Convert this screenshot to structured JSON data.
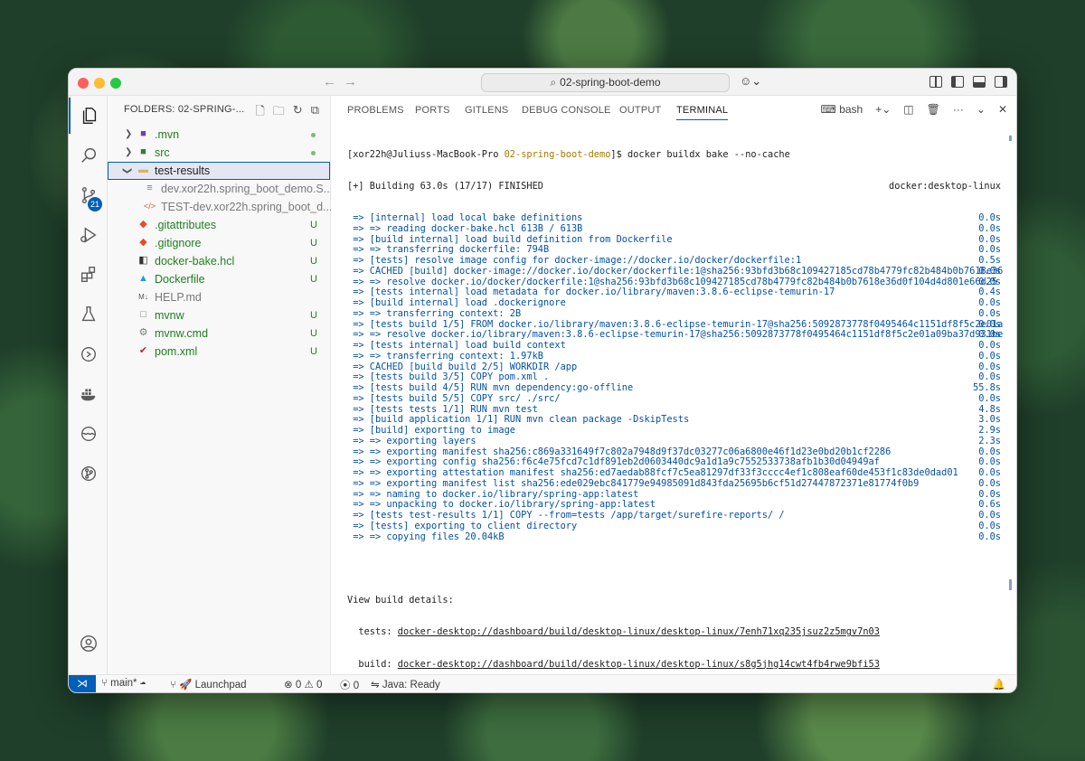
{
  "titlebar": {
    "search_text": "02-spring-boot-demo",
    "search_icon": "search-icon",
    "copilot_icon": "copilot-icon"
  },
  "activity_bar": {
    "items": [
      "explorer-icon",
      "search-icon",
      "source-control-icon",
      "run-debug-icon",
      "extensions-icon",
      "testing-icon",
      "remote-explorer-icon",
      "docker-icon",
      "wave-icon",
      "git-graph-icon",
      "account-icon",
      "settings-gear-icon"
    ],
    "source_control_badge": "21"
  },
  "sidebar": {
    "header": "FOLDERS: 02-SPRING-...",
    "items": [
      {
        "name": ".mvn",
        "status": "dot",
        "kind": "folder"
      },
      {
        "name": "src",
        "status": "dot",
        "kind": "folder"
      },
      {
        "name": "test-results",
        "status": "",
        "kind": "folder-open"
      },
      {
        "name": "dev.xor22h.spring_boot_demo.S...",
        "status": "",
        "kind": "file"
      },
      {
        "name": "TEST-dev.xor22h.spring_boot_d...",
        "status": "",
        "kind": "file"
      },
      {
        "name": ".gitattributes",
        "status": "U",
        "kind": "file"
      },
      {
        "name": ".gitignore",
        "status": "U",
        "kind": "file"
      },
      {
        "name": "docker-bake.hcl",
        "status": "U",
        "kind": "file"
      },
      {
        "name": "Dockerfile",
        "status": "U",
        "kind": "file"
      },
      {
        "name": "HELP.md",
        "status": "",
        "kind": "file"
      },
      {
        "name": "mvnw",
        "status": "U",
        "kind": "file"
      },
      {
        "name": "mvnw.cmd",
        "status": "U",
        "kind": "file"
      },
      {
        "name": "pom.xml",
        "status": "U",
        "kind": "file"
      }
    ]
  },
  "panel": {
    "tabs": [
      "PROBLEMS",
      "PORTS",
      "GITLENS",
      "DEBUG CONSOLE",
      "OUTPUT",
      "TERMINAL"
    ],
    "active_tab": "TERMINAL",
    "shell_label": "bash"
  },
  "terminal": {
    "prompt_user": "xor22h",
    "prompt_host": "Juliuss-MacBook-Pro",
    "prompt_dir": "02-spring-boot-demo",
    "command": "$ docker buildx bake --no-cache",
    "header": "[+] Building 63.0s (17/17) FINISHED",
    "header_right": "docker:desktop-linux",
    "lines": [
      {
        "text": " => [internal] load local bake definitions",
        "dur": "0.0s"
      },
      {
        "text": " => => reading docker-bake.hcl 613B / 613B",
        "dur": "0.0s"
      },
      {
        "text": " => [build internal] load build definition from Dockerfile",
        "dur": "0.0s"
      },
      {
        "text": " => => transferring dockerfile: 794B",
        "dur": "0.0s"
      },
      {
        "text": " => [tests] resolve image config for docker-image://docker.io/docker/dockerfile:1",
        "dur": "0.5s"
      },
      {
        "text": " => CACHED [build] docker-image://docker.io/docker/dockerfile:1@sha256:93bfd3b68c109427185cd78b4779fc82b484b0b7618e36",
        "dur": "0.0s"
      },
      {
        "text": " => => resolve docker.io/docker/dockerfile:1@sha256:93bfd3b68c109427185cd78b4779fc82b484b0b7618e36d0f104d4d801e66d25",
        "dur": "0.0s"
      },
      {
        "text": " => [tests internal] load metadata for docker.io/library/maven:3.8.6-eclipse-temurin-17",
        "dur": "0.4s"
      },
      {
        "text": " => [build internal] load .dockerignore",
        "dur": "0.0s"
      },
      {
        "text": " => => transferring context: 2B",
        "dur": "0.0s"
      },
      {
        "text": " => [tests build 1/5] FROM docker.io/library/maven:3.8.6-eclipse-temurin-17@sha256:5092873778f0495464c1151df8f5c2e01a",
        "dur": "0.0s"
      },
      {
        "text": " => => resolve docker.io/library/maven:3.8.6-eclipse-temurin-17@sha256:5092873778f0495464c1151df8f5c2e01a09ba37d931be",
        "dur": "0.0s"
      },
      {
        "text": " => [tests internal] load build context",
        "dur": "0.0s"
      },
      {
        "text": " => => transferring context: 1.97kB",
        "dur": "0.0s"
      },
      {
        "text": " => CACHED [build build 2/5] WORKDIR /app",
        "dur": "0.0s"
      },
      {
        "text": " => [tests build 3/5] COPY pom.xml .",
        "dur": "0.0s"
      },
      {
        "text": " => [tests build 4/5] RUN mvn dependency:go-offline",
        "dur": "55.8s"
      },
      {
        "text": " => [tests build 5/5] COPY src/ ./src/",
        "dur": "0.0s"
      },
      {
        "text": " => [tests tests 1/1] RUN mvn test",
        "dur": "4.8s"
      },
      {
        "text": " => [build application 1/1] RUN mvn clean package -DskipTests",
        "dur": "3.0s"
      },
      {
        "text": " => [build] exporting to image",
        "dur": "2.9s"
      },
      {
        "text": " => => exporting layers",
        "dur": "2.3s"
      },
      {
        "text": " => => exporting manifest sha256:c869a331649f7c802a7948d9f37dc03277c06a6800e46f1d23e0bd20b1cf2286",
        "dur": "0.0s"
      },
      {
        "text": " => => exporting config sha256:f6c4e75fcd7c1df891eb2d0603440dc9a1d1a9c7552533738afb1b30d04949af",
        "dur": "0.0s"
      },
      {
        "text": " => => exporting attestation manifest sha256:ed7aedab88fcf7c5ea81297df33f3cccc4ef1c808eaf60de453f1c83de0dad01",
        "dur": "0.0s"
      },
      {
        "text": " => => exporting manifest list sha256:ede029ebc841779e94985091d843fda25695b6cf51d27447872371e81774f0b9",
        "dur": "0.0s"
      },
      {
        "text": " => => naming to docker.io/library/spring-app:latest",
        "dur": "0.0s"
      },
      {
        "text": " => => unpacking to docker.io/library/spring-app:latest",
        "dur": "0.6s"
      },
      {
        "text": " => [tests test-results 1/1] COPY --from=tests /app/target/surefire-reports/ /",
        "dur": "0.0s"
      },
      {
        "text": " => [tests] exporting to client directory",
        "dur": "0.0s"
      },
      {
        "text": " => => copying files 20.04kB",
        "dur": "0.0s"
      }
    ],
    "details_header": "View build details:",
    "details_tests_label": "  tests: ",
    "details_tests_url": "docker-desktop://dashboard/build/desktop-linux/desktop-linux/7enh71xq235jsuz2z5mgv7n03",
    "details_build_label": "  build: ",
    "details_build_url": "docker-desktop://dashboard/build/desktop-linux/desktop-linux/s8g5jhg14cwt4fb4rwe9bfi53"
  },
  "statusbar": {
    "branch": "main*",
    "launchpad": "Launchpad",
    "errors": "0",
    "warnings": "0",
    "ports": "0",
    "java": "Java: Ready"
  },
  "colors": {
    "accent": "#005fb8",
    "terminal_blue": "#0451a5",
    "git_untracked": "#1f7f1f",
    "prompt_dir": "#a37a00"
  }
}
